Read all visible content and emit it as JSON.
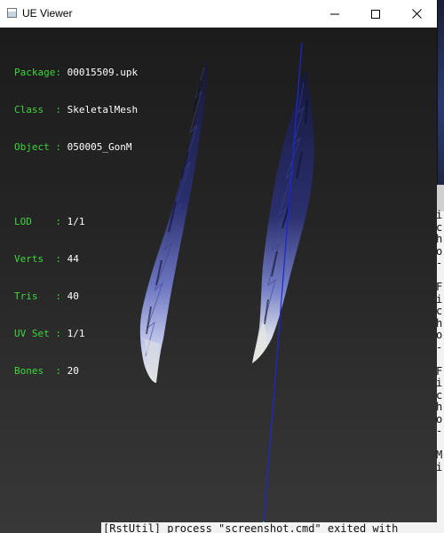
{
  "window": {
    "title": "UE Viewer",
    "icon": "app-icon",
    "controls": {
      "minimize": "minimize-icon",
      "maximize": "maximize-icon",
      "close": "close-icon"
    }
  },
  "info": {
    "package_label": "Package:",
    "package_value": "00015509.upk",
    "class_label": "Class  :",
    "class_value": "SkeletalMesh",
    "object_label": "Object :",
    "object_value": "050005_GonM",
    "lod_label": "LOD    :",
    "lod_value": "1/1",
    "verts_label": "Verts  :",
    "verts_value": "44",
    "tris_label": "Tris   :",
    "tris_value": "40",
    "uvset_label": "UV Set :",
    "uvset_value": "1/1",
    "bones_label": "Bones  :",
    "bones_value": "20"
  },
  "colors": {
    "label_green": "#3cd63c",
    "value_white": "#ffffff",
    "bone_line": "#1a28d8",
    "mesh_dark": "#1c1f45",
    "mesh_light": "#c9d2f0"
  },
  "background": {
    "left_edge_char": "M",
    "console_lines": [
      "i",
      "c",
      "h",
      "o",
      "-",
      "",
      "F",
      "i",
      "c",
      "h",
      "o",
      "-",
      "",
      "F",
      "i",
      "c",
      "h",
      "o",
      "-",
      "",
      "M",
      "i"
    ],
    "status_line": "[RstUtil] process \"screenshot.cmd\" exited with"
  }
}
